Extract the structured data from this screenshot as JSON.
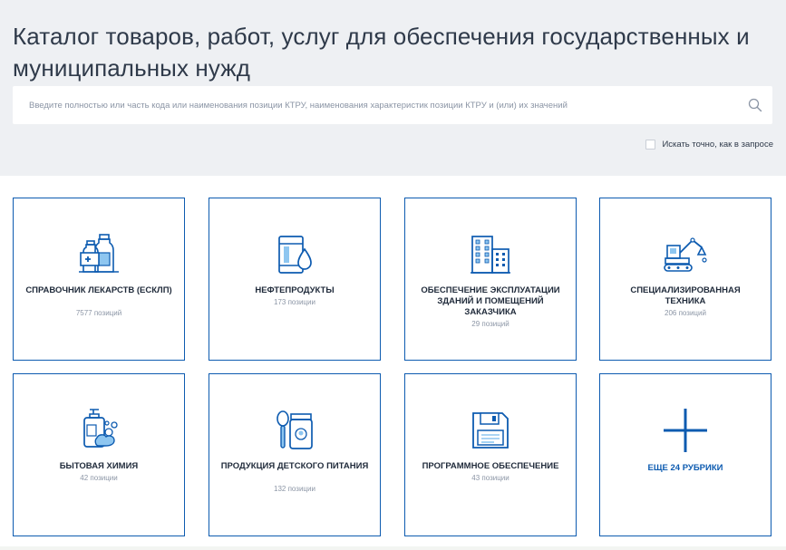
{
  "page": {
    "title": "Каталог товаров, работ, услуг для обеспечения государственных и муниципальных нужд"
  },
  "search": {
    "placeholder": "Введите полностью или часть кода или наименования позиции КТРУ, наименования характеристик позиции КТРУ и (или) их значений",
    "value": "",
    "exact_label": "Искать точно, как в запросе",
    "exact_checked": false
  },
  "categories": [
    {
      "label": "СПРАВОЧНИК ЛЕКАРСТВ (ЕСКЛП)",
      "count": "7577 позиций",
      "icon": "medicine-icon"
    },
    {
      "label": "НЕФТЕПРОДУКТЫ",
      "count": "173 позиции",
      "icon": "oil-barrel-icon"
    },
    {
      "label": "ОБЕСПЕЧЕНИЕ ЭКСПЛУАТАЦИИ ЗДАНИЙ И ПОМЕЩЕНИЙ ЗАКАЗЧИКА",
      "count": "29 позиций",
      "icon": "buildings-icon"
    },
    {
      "label": "СПЕЦИАЛИЗИРОВАННАЯ ТЕХНИКА",
      "count": "206 позиций",
      "icon": "excavator-icon"
    },
    {
      "label": "БЫТОВАЯ ХИМИЯ",
      "count": "42 позиции",
      "icon": "detergent-icon"
    },
    {
      "label": "ПРОДУКЦИЯ ДЕТСКОГО ПИТАНИЯ",
      "count": "132 позиции",
      "icon": "baby-food-icon"
    },
    {
      "label": "ПРОГРАММНОЕ ОБЕСПЕЧЕНИЕ",
      "count": "43 позиции",
      "icon": "floppy-disk-icon"
    }
  ],
  "more_rubrics": {
    "label": "ЕЩЕ 24 РУБРИКИ",
    "icon": "plus-icon"
  },
  "colors": {
    "accent": "#0d5bb0",
    "header_bg": "#eef0f3",
    "muted": "#8b95a5",
    "text": "#2f3a4a"
  }
}
